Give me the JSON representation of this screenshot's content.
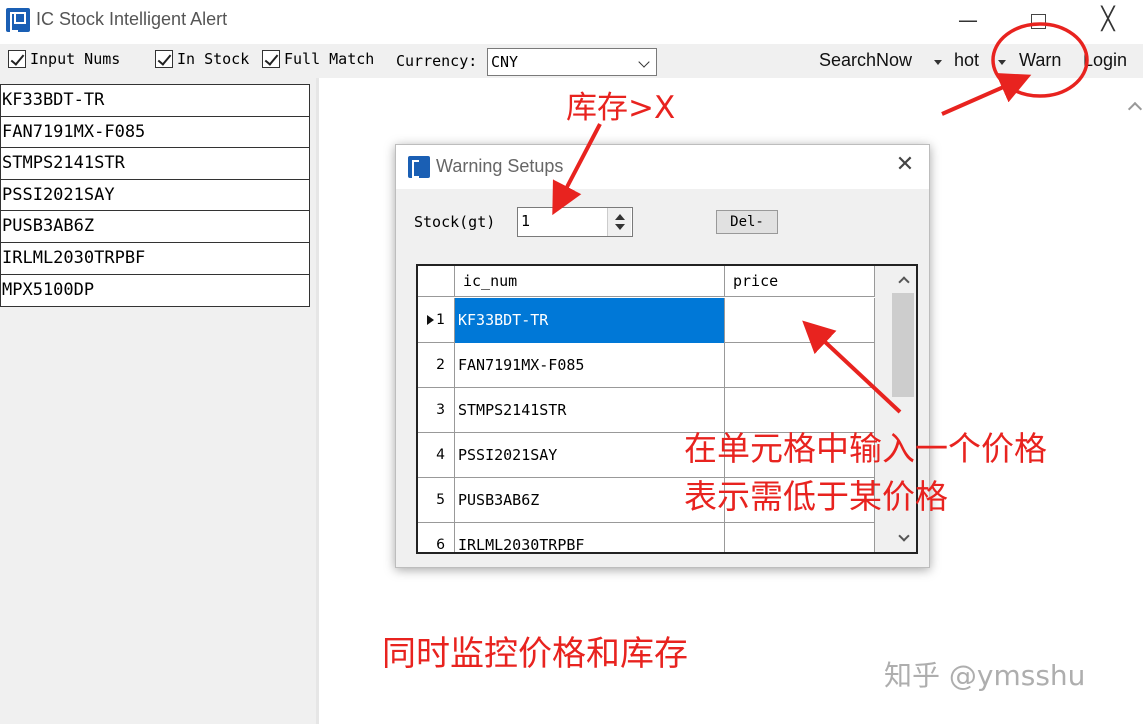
{
  "window": {
    "title": "IC Stock Intelligent Alert",
    "controls": {
      "minimize": "—",
      "close": "╳"
    }
  },
  "toolbar": {
    "checkboxes": [
      {
        "label": "Input Nums",
        "checked": true
      },
      {
        "label": "In Stock",
        "checked": true
      },
      {
        "label": "Full Match",
        "checked": true
      }
    ],
    "currency_label": "Currency:",
    "currency_value": "CNY",
    "menu": [
      "SearchNow",
      "hot",
      "Warn",
      "Login"
    ]
  },
  "parts_list": [
    "KF33BDT-TR",
    "FAN7191MX-F085",
    "STMPS2141STR",
    "PSSI2021SAY",
    "PUSB3AB6Z",
    "IRLML2030TRPBF",
    "MPX5100DP"
  ],
  "dialog": {
    "title": "Warning Setups",
    "stock_label": "Stock(gt)",
    "stock_value": "1",
    "del_button": "Del-",
    "grid": {
      "columns": [
        "ic_num",
        "price"
      ],
      "rows": [
        {
          "num": "1",
          "ic_num": "KF33BDT-TR",
          "price": "",
          "selected": true
        },
        {
          "num": "2",
          "ic_num": "FAN7191MX-F085",
          "price": ""
        },
        {
          "num": "3",
          "ic_num": "STMPS2141STR",
          "price": ""
        },
        {
          "num": "4",
          "ic_num": "PSSI2021SAY",
          "price": ""
        },
        {
          "num": "5",
          "ic_num": "PUSB3AB6Z",
          "price": ""
        },
        {
          "num": "6",
          "ic_num": "IRLML2030TRPBF",
          "price": ""
        }
      ]
    }
  },
  "annotations": {
    "stock": "库存>X",
    "price_line1": "在单元格中输入一个价格",
    "price_line2": "表示需低于某价格",
    "monitor": "同时监控价格和库存"
  },
  "watermark": "知乎 @ymsshu",
  "colors": {
    "annotation": "#e8231f",
    "selection": "#0078d7",
    "app_icon": "#1a5fb4"
  }
}
